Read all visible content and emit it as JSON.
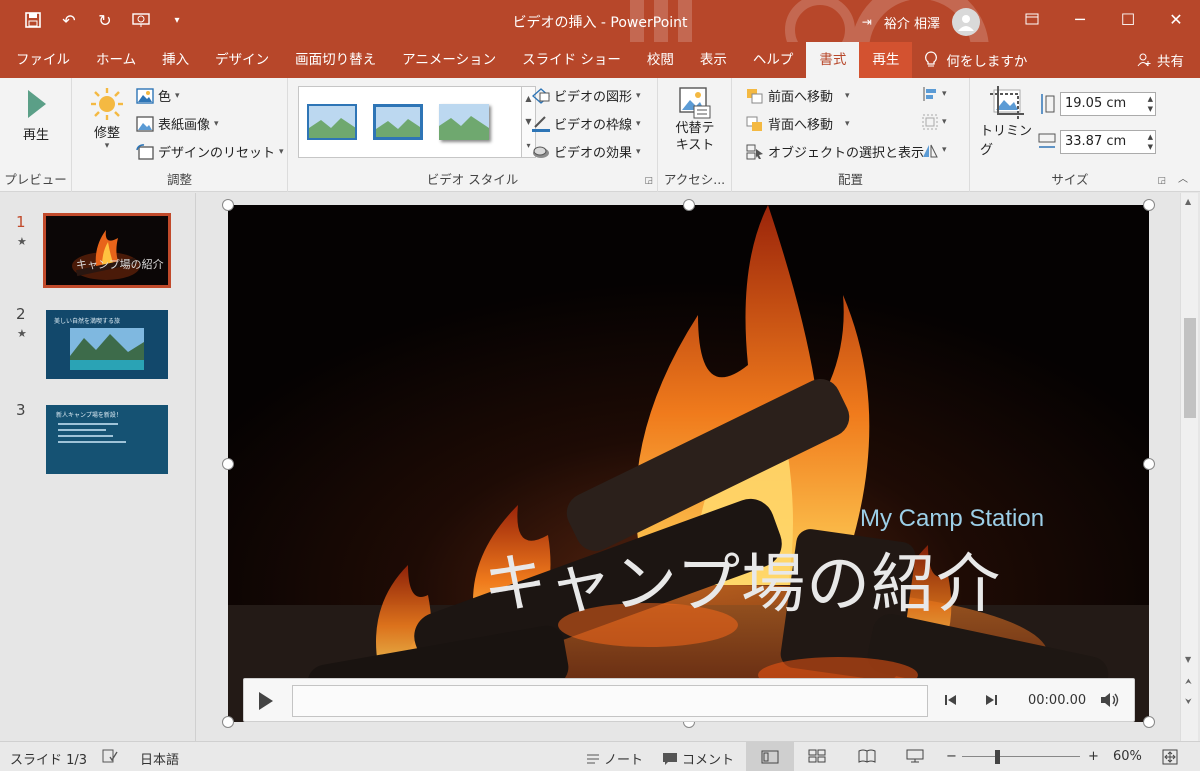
{
  "window": {
    "title": "ビデオの挿入 - PowerPoint",
    "user_name": "裕介 相澤",
    "brand_color": "#b7472a"
  },
  "tabs": [
    {
      "label": "ファイル"
    },
    {
      "label": "ホーム"
    },
    {
      "label": "挿入"
    },
    {
      "label": "デザイン"
    },
    {
      "label": "画面切り替え"
    },
    {
      "label": "アニメーション"
    },
    {
      "label": "スライド ショー"
    },
    {
      "label": "校閲"
    },
    {
      "label": "表示"
    },
    {
      "label": "ヘルプ"
    },
    {
      "label": "書式"
    },
    {
      "label": "再生"
    }
  ],
  "tell_me": "何をしますか",
  "share": "共有",
  "ribbon": {
    "preview": {
      "play": "再生",
      "group_label": "プレビュー"
    },
    "adjust": {
      "correct": "修整",
      "color": "色",
      "poster": "表紙画像",
      "reset": "デザインのリセット",
      "group_label": "調整"
    },
    "video_styles": {
      "shape": "ビデオの図形",
      "border": "ビデオの枠線",
      "effects": "ビデオの効果",
      "group_label": "ビデオ スタイル"
    },
    "accessibility": {
      "alt_text": "代替テキスト",
      "alt_text_line1": "代替テ",
      "alt_text_line2": "キスト",
      "group_label": "アクセシ..."
    },
    "arrange": {
      "bring_forward": "前面へ移動",
      "send_backward": "背面へ移動",
      "selection_pane": "オブジェクトの選択と表示",
      "group_label": "配置"
    },
    "size": {
      "crop": "トリミング",
      "height": "19.05 cm",
      "width": "33.87 cm",
      "group_label": "サイズ"
    }
  },
  "slides": [
    {
      "number": "1",
      "title": "キャンプ場の紹介"
    },
    {
      "number": "2",
      "title": "美しい自然を満喫する旅"
    },
    {
      "number": "3",
      "title": "新人キャンプ場を新設！"
    }
  ],
  "slide": {
    "subtitle": "My Camp Station",
    "title": "キャンプ場の紹介"
  },
  "video_controls": {
    "time": "00:00.00"
  },
  "status": {
    "slide_indicator": "スライド 1/3",
    "language": "日本語",
    "notes": "ノート",
    "comments": "コメント",
    "zoom": "60%"
  }
}
